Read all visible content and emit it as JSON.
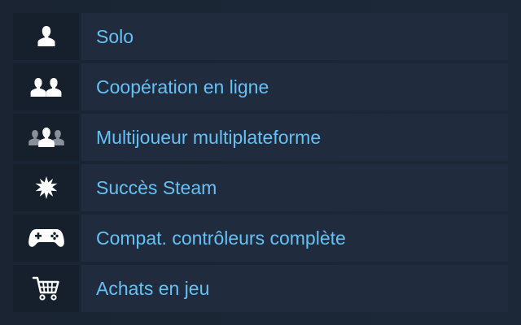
{
  "features": [
    {
      "label": "Solo",
      "icon": "single-player-icon"
    },
    {
      "label": "Coopération en ligne",
      "icon": "online-coop-icon"
    },
    {
      "label": "Multijoueur multiplateforme",
      "icon": "cross-platform-multiplayer-icon"
    },
    {
      "label": "Succès Steam",
      "icon": "steam-achievements-icon"
    },
    {
      "label": "Compat. contrôleurs complète",
      "icon": "gamepad-icon"
    },
    {
      "label": "Achats en jeu",
      "icon": "shopping-cart-icon"
    }
  ],
  "colors": {
    "background": "#1b2838",
    "icon_cell": "#16202d",
    "label_cell": "#202c3d",
    "label_text": "#66c0f4",
    "icon": "#ffffff"
  }
}
